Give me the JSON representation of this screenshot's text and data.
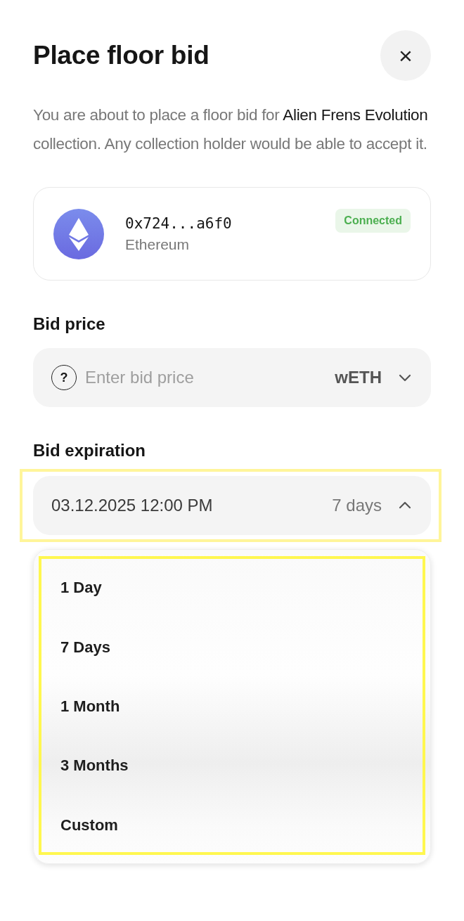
{
  "title": "Place floor bid",
  "close": "×",
  "description": "You are about to place a floor bid for **Alien Frens Evolution** collection. Any collection holder would be able to accept it.",
  "wallet": {
    "address": "0x724...a6f0",
    "network": "Ethereum",
    "status": "Connected",
    "connected": true
  },
  "bid_price": {
    "label": "Bid price",
    "help": "?",
    "placeholder": "Enter bid price",
    "currency": "wETH"
  },
  "bid_expiration": {
    "label": "Bid expiration",
    "value": "03.12.2025 12:00 PM",
    "duration": "7 days",
    "expanded": true,
    "highlighted": true
  },
  "expiration_options": {
    "highlighted": true,
    "items": [
      {
        "label": "1 Day"
      },
      {
        "label": "7 Days"
      },
      {
        "label": "1 Month"
      },
      {
        "label": "3 Months"
      },
      {
        "label": "Custom"
      }
    ]
  }
}
